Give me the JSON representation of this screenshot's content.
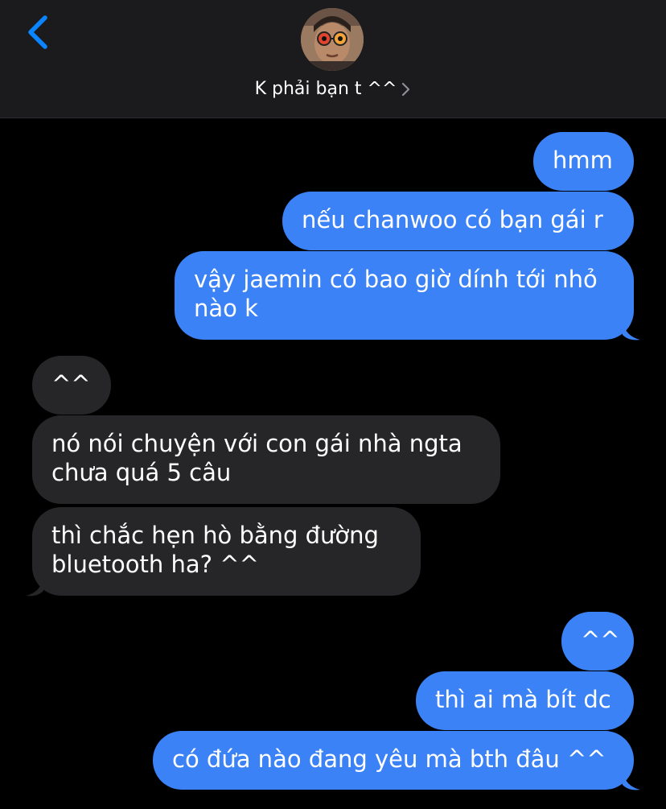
{
  "header": {
    "contact_name": "K phải bạn t ^^",
    "back_icon": "chevron-left-icon",
    "avatar": "contact-avatar",
    "chevron_icon": "chevron-right-icon"
  },
  "colors": {
    "outgoing": "#3b82f6",
    "incoming": "#262628",
    "background": "#000000",
    "accent": "#0a84ff"
  },
  "messages": [
    {
      "dir": "out",
      "lines": [
        "hmm"
      ]
    },
    {
      "dir": "out",
      "lines": [
        "nếu chanwoo có bạn gái r"
      ]
    },
    {
      "dir": "out",
      "lines": [
        "vậy jaemin có bao giờ dính tới nhỏ",
        "nào k"
      ]
    },
    {
      "dir": "in",
      "lines": [
        "^^"
      ]
    },
    {
      "dir": "in",
      "lines": [
        "nó nói chuyện với con gái nhà ngta",
        "chưa quá 5 câu"
      ]
    },
    {
      "dir": "in",
      "lines": [
        "thì chắc hẹn hò bằng đường",
        "bluetooth ha? ^^"
      ]
    },
    {
      "dir": "out",
      "lines": [
        "^^"
      ]
    },
    {
      "dir": "out",
      "lines": [
        "thì ai mà bít dc"
      ]
    },
    {
      "dir": "out",
      "lines": [
        "có đứa nào đang yêu mà bth đâu ^^"
      ]
    }
  ]
}
